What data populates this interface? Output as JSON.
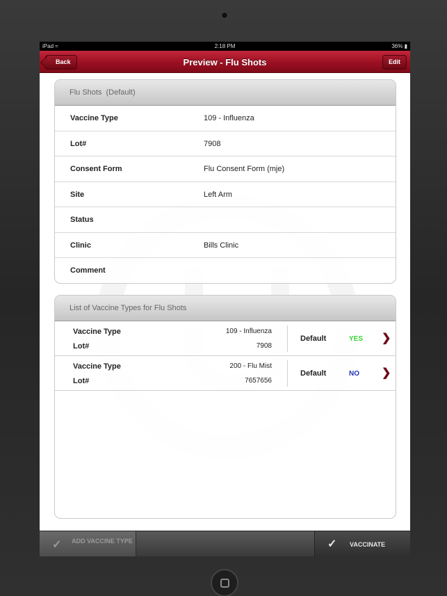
{
  "status_bar": {
    "carrier": "iPad",
    "wifi_icon": "wifi-icon",
    "time": "2:18 PM",
    "battery": "36%"
  },
  "nav": {
    "back_label": "Back",
    "title": "Preview - Flu Shots",
    "edit_label": "Edit"
  },
  "details": {
    "header_title": "Flu Shots",
    "header_suffix": "(Default)",
    "rows": [
      {
        "label": "Vaccine Type",
        "value": "109 - Influenza"
      },
      {
        "label": "Lot#",
        "value": "7908"
      },
      {
        "label": "Consent Form",
        "value": "Flu Consent Form (mje)"
      },
      {
        "label": "Site",
        "value": "Left Arm"
      },
      {
        "label": "Status",
        "value": ""
      },
      {
        "label": "Clinic",
        "value": "Bills Clinic"
      },
      {
        "label": "Comment",
        "value": ""
      }
    ]
  },
  "vaccine_list": {
    "header_title": "List of Vaccine Types for Flu Shots",
    "items": [
      {
        "type_label": "Vaccine Type",
        "type_value": "109 - Influenza",
        "lot_label": "Lot#",
        "lot_value": "7908",
        "default_label": "Default",
        "default_value": "YES",
        "default_color": "#39d239"
      },
      {
        "type_label": "Vaccine Type",
        "type_value": "200 - Flu Mist",
        "lot_label": "Lot#",
        "lot_value": "7657656",
        "default_label": "Default",
        "default_value": "NO",
        "default_color": "#2233b8"
      }
    ]
  },
  "toolbar": {
    "add_label": "ADD VACCINE TYPE",
    "add_icon": "syringe-icon",
    "vaccinate_label": "VACCINATE",
    "vaccinate_icon": "syringe-icon"
  },
  "colors": {
    "nav_accent": "#9b1022",
    "chevron": "#6d0b1a"
  }
}
